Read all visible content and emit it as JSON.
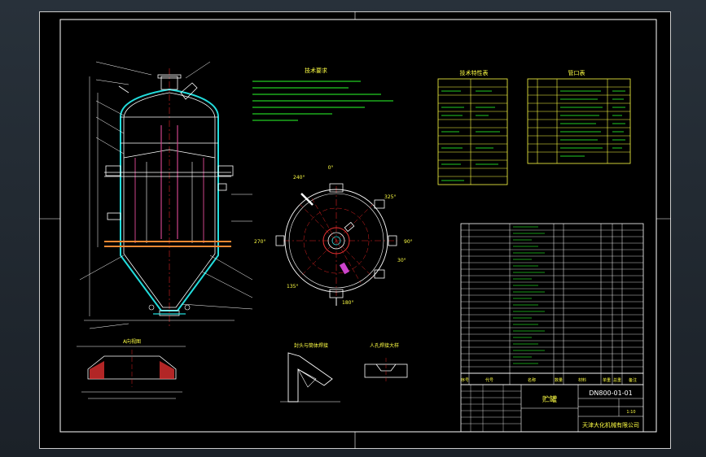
{
  "drawing": {
    "title": "DN800-01-01",
    "name": "贮罐",
    "company": "天津大化机械有限公司",
    "scale": "1:10",
    "notes_title": "技术要求",
    "tech_table_title": "技术特性表",
    "nozzle_table_title": "管口表",
    "detail_a_title": "A向视图",
    "detail_b_title": "封头与筒体焊接",
    "detail_c_title": "人孔焊接大样",
    "orientation_labels": [
      "0°",
      "30°",
      "90°",
      "135°",
      "180°",
      "240°",
      "270°",
      "325°"
    ],
    "bom_header": [
      "序号",
      "代号",
      "名称",
      "数量",
      "材料",
      "单重",
      "总重",
      "备注"
    ]
  }
}
